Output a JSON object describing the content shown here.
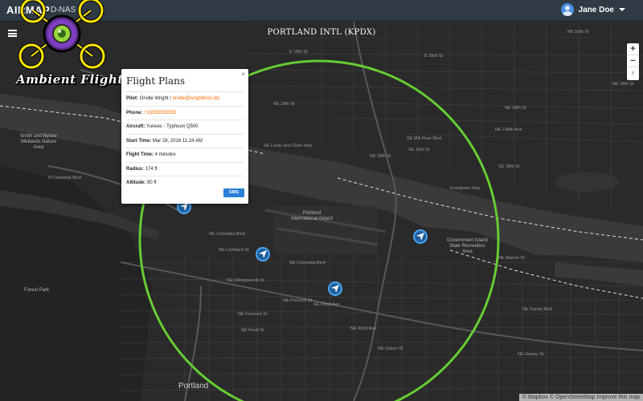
{
  "nav": {
    "brand": "AIRMAP",
    "product": "D-NAS",
    "user_name": "Jane Doe"
  },
  "logo": {
    "text": "Ambient Flight",
    "icon": "quadcopter-logo"
  },
  "map": {
    "title": "PORTLAND INTL (KPDX)",
    "zoom_in": "+",
    "zoom_out": "−",
    "compass": "↑",
    "attribution": "© Mapbox © OpenStreetMap Improve this map",
    "radius_color": "#66cc33",
    "drone_color": "#1f5f9e",
    "places": {
      "smith_bybee": "Smith and Bybee\nWetlands Nature\nArea",
      "portland_airport": "Portland\nInternational Airport",
      "government_island": "Government Island\nState Recreation\nArea",
      "forest_park": "Forest Park",
      "portland_city": "Portland"
    },
    "streets": [
      "NE 50th St",
      "NE 28th St",
      "NE 28th St",
      "NE 28th St",
      "NE 28th St",
      "SE 28th St",
      "SE Mill Plain Blvd",
      "SE 16th St",
      "NE 148th Ave",
      "NE 82nd Ave",
      "NE Columbia Blvd",
      "NE Lombard St",
      "NE Killingsworth St",
      "NE Prescott St",
      "NE Fremont St",
      "NE Knott St",
      "NE Glisan St",
      "NE Halsey St",
      "NE Sandy Blvd",
      "NE Marine Dr",
      "Evergreen Hwy",
      "NE Columbia Blvd",
      "SE Lewis and Clark Hwy",
      "N Columbia Blvd",
      "E 33rd St",
      "E 18th St",
      "NE 42nd Ave"
    ]
  },
  "popup": {
    "title": "Flight Plans",
    "close": "×",
    "pilot_label": "Pilot:",
    "pilot_name": "Orville Wright",
    "pilot_email": "orville@wrightbros.biz",
    "phone_label": "Phone:",
    "phone_value": "+15555555555",
    "aircraft_label": "Aircraft:",
    "aircraft_value": "Yuneec - Typhoon Q500",
    "start_label": "Start Time:",
    "start_value": "Mar 28, 2016 11:24 AM",
    "duration_label": "Flight Time:",
    "duration_value": "4 minutes",
    "radius_label": "Radius:",
    "radius_value": "174 ft",
    "altitude_label": "Altitude:",
    "altitude_value": "90 ft",
    "sms_label": "SMS"
  }
}
